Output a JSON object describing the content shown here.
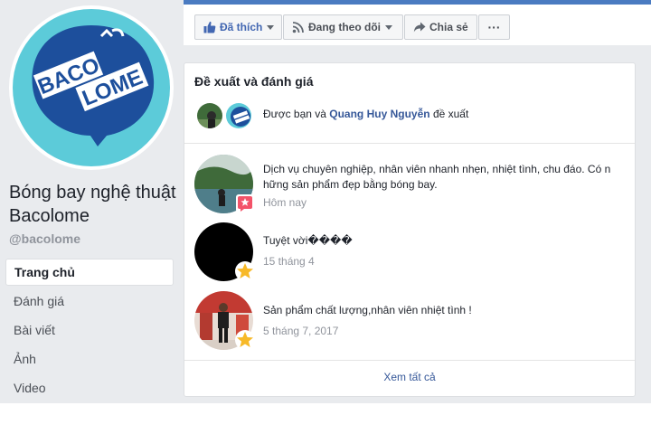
{
  "page": {
    "name": "Bóng bay nghệ thuật Bacolome",
    "username": "@bacolome",
    "logo_line1": "BACO",
    "logo_line2": "LOME"
  },
  "nav": [
    {
      "label": "Trang chủ",
      "active": true
    },
    {
      "label": "Đánh giá",
      "active": false
    },
    {
      "label": "Bài viết",
      "active": false
    },
    {
      "label": "Ảnh",
      "active": false
    },
    {
      "label": "Video",
      "active": false
    }
  ],
  "actions": {
    "like": "Đã thích",
    "follow": "Đang theo dõi",
    "share": "Chia sẻ",
    "more": "···"
  },
  "recommendations": {
    "title": "Đề xuất và đánh giá",
    "rec_prefix": "Được bạn và ",
    "rec_name": "Quang Huy Nguyễn",
    "rec_suffix": " đề xuất",
    "reviews": [
      {
        "text": "Dịch vụ chuyên nghiệp, nhân viên nhanh nhẹn, nhiệt tình, chu đáo. Có n hững sản phẩm đẹp bằng bóng bay.",
        "date": "Hôm nay",
        "badge": "recommend"
      },
      {
        "text": "Tuyệt vời����",
        "date": "15 tháng 4",
        "badge": "star"
      },
      {
        "text": "Sản phẩm chất lượng,nhân viên nhiệt tình !",
        "date": "5 tháng 7, 2017",
        "badge": "star"
      }
    ],
    "see_all": "Xem tất cả"
  },
  "colors": {
    "link": "#365899",
    "brand_blue": "#1d4f9c",
    "cyan": "#5ccbd9",
    "recommend_badge": "#f35369",
    "star": "#f7b928"
  }
}
